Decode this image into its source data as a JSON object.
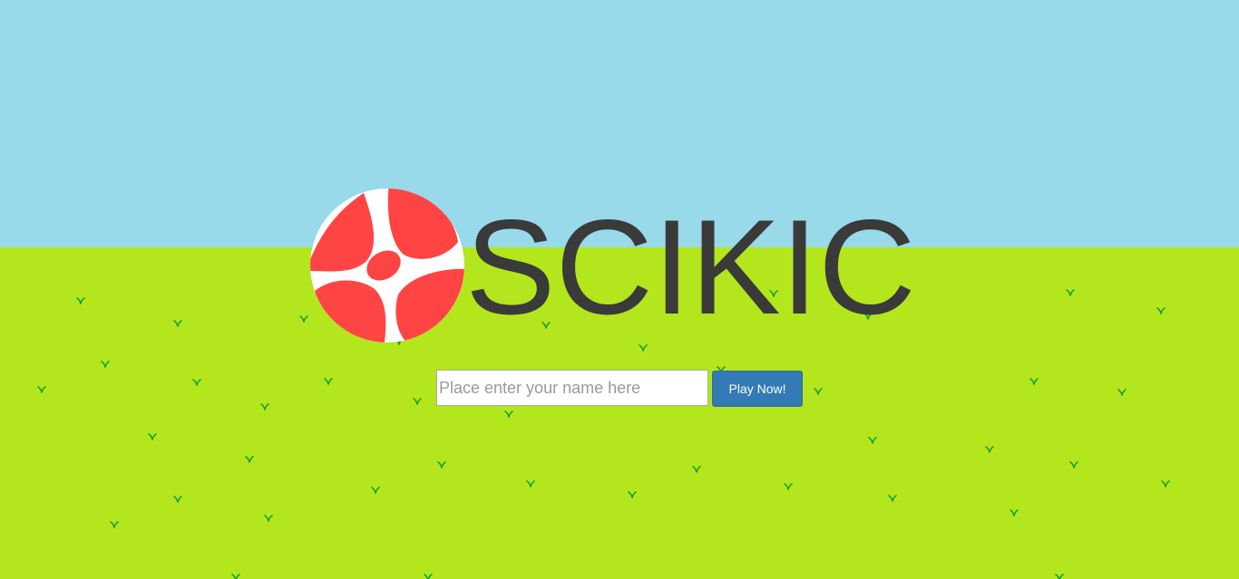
{
  "colors": {
    "sky": "#98d9ea",
    "grass": "#b3e61c",
    "tuft": "#11a232",
    "logo_text": "#3a3a3a",
    "ball_red": "#ff4444",
    "ball_white": "#ffffff",
    "button_bg": "#337ab7"
  },
  "logo": {
    "text": "SCIKIC",
    "icon": "soccer-ball-icon"
  },
  "join_form": {
    "name_placeholder": "Place enter your name here",
    "name_value": "",
    "play_label": "Play Now!"
  },
  "decorations": {
    "icon": "grass-tuft-icon"
  }
}
